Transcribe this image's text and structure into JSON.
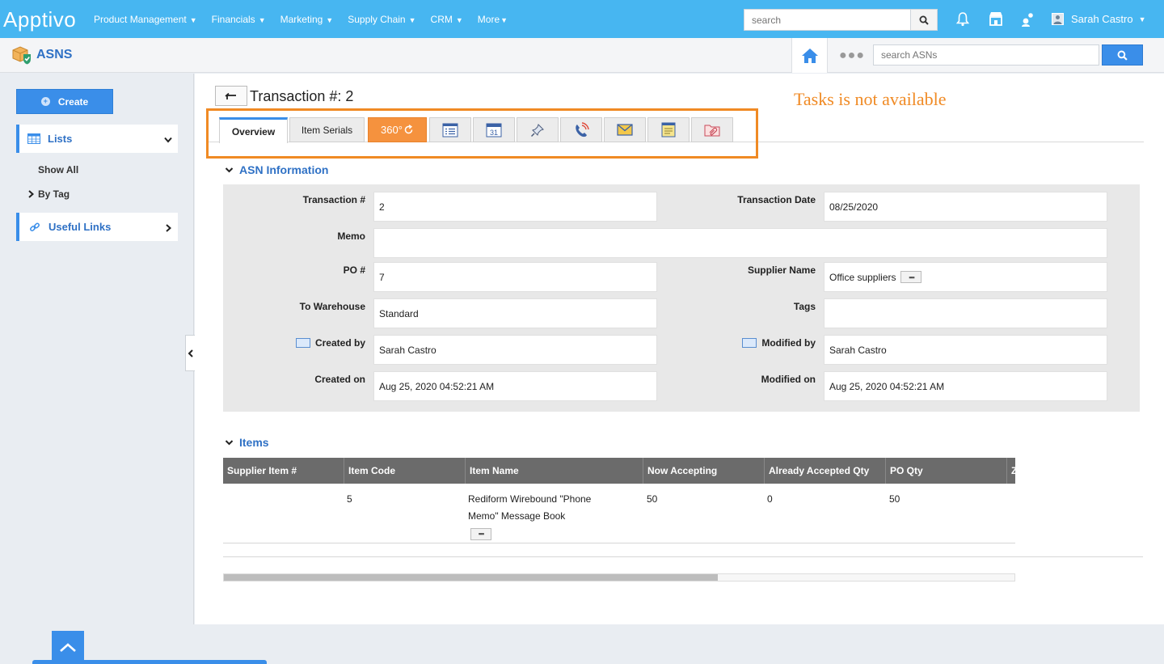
{
  "brand": {
    "logo_text": "Apptivo"
  },
  "topnav": {
    "items": [
      {
        "label": "Product Management"
      },
      {
        "label": "Financials"
      },
      {
        "label": "Marketing"
      },
      {
        "label": "Supply Chain"
      },
      {
        "label": "CRM"
      },
      {
        "label": "More"
      }
    ],
    "search_placeholder": "search",
    "user_name": "Sarah Castro"
  },
  "app": {
    "title": "ASNS",
    "search_placeholder": "search ASNs"
  },
  "sidebar": {
    "create_label": "Create",
    "lists_label": "Lists",
    "show_all": "Show All",
    "by_tag": "By Tag",
    "useful_links": "Useful Links"
  },
  "page": {
    "title": "Transaction #: 2",
    "note": "Tasks is not available",
    "tabs": [
      {
        "label": "Overview"
      },
      {
        "label": "Item Serials"
      },
      {
        "label": "360°"
      }
    ],
    "tab_icons": [
      "list-icon",
      "calendar-icon",
      "pin-icon",
      "phone-icon",
      "email-icon",
      "notes-icon",
      "attachment-icon"
    ],
    "calendar_day": "31"
  },
  "asn": {
    "section_title": "ASN Information",
    "fields": {
      "transaction_no": {
        "label": "Transaction #",
        "value": "2"
      },
      "transaction_date": {
        "label": "Transaction Date",
        "value": "08/25/2020"
      },
      "memo": {
        "label": "Memo",
        "value": ""
      },
      "po_no": {
        "label": "PO #",
        "value": "7"
      },
      "supplier_name": {
        "label": "Supplier Name",
        "value": "Office suppliers"
      },
      "to_warehouse": {
        "label": "To Warehouse",
        "value": "Standard"
      },
      "tags": {
        "label": "Tags",
        "value": ""
      },
      "created_by": {
        "label": "Created by",
        "value": "Sarah Castro"
      },
      "modified_by": {
        "label": "Modified by",
        "value": "Sarah Castro"
      },
      "created_on": {
        "label": "Created on",
        "value": "Aug 25, 2020 04:52:21 AM"
      },
      "modified_on": {
        "label": "Modified on",
        "value": "Aug 25, 2020 04:52:21 AM"
      }
    }
  },
  "items": {
    "section_title": "Items",
    "columns": [
      "Supplier Item #",
      "Item Code",
      "Item Name",
      "Now Accepting",
      "Already Accepted Qty",
      "PO Qty",
      "Z"
    ],
    "rows": [
      {
        "supplier_item": "",
        "item_code": "5",
        "item_name_line1": "Rediform Wirebound \"Phone",
        "item_name_line2": "Memo\" Message Book",
        "now_accepting": "50",
        "already_accepted": "0",
        "po_qty": "50"
      }
    ],
    "scroll_fraction": 0.625
  },
  "colors": {
    "topbar": "#47b6f1",
    "accent": "#3a8ee9",
    "highlight": "#f08a24",
    "tab_360": "#f5923e"
  }
}
